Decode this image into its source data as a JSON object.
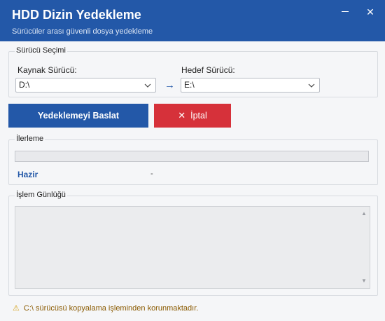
{
  "window": {
    "title": "HDD Dizin Yedekleme",
    "subtitle": "Sürücüler arası güvenli dosya yedekleme",
    "minimize_icon": "minimize-icon",
    "close_glyph": "✕"
  },
  "drive_selection": {
    "legend": "Sürücü Seçimi",
    "source_label": "Kaynak Sürücü:",
    "source_value": "D:\\",
    "target_label": "Hedef Sürücü:",
    "target_value": "E:\\",
    "arrow_glyph": "→"
  },
  "actions": {
    "start_label": "Yedeklemeyi Baslat",
    "cancel_label": "İptal",
    "cancel_icon_glyph": "✕",
    "start_color": "#2358a8",
    "cancel_color": "#d6313a"
  },
  "progress": {
    "legend": "İlerleme",
    "status": "Hazir",
    "detail": "-",
    "fraction": 0
  },
  "log": {
    "legend": "İşlem Günlüğü",
    "entries": []
  },
  "footer": {
    "warning_icon": "⚠",
    "warning_text": "C:\\ sürücüsü kopyalama işleminden korunmaktadır."
  }
}
